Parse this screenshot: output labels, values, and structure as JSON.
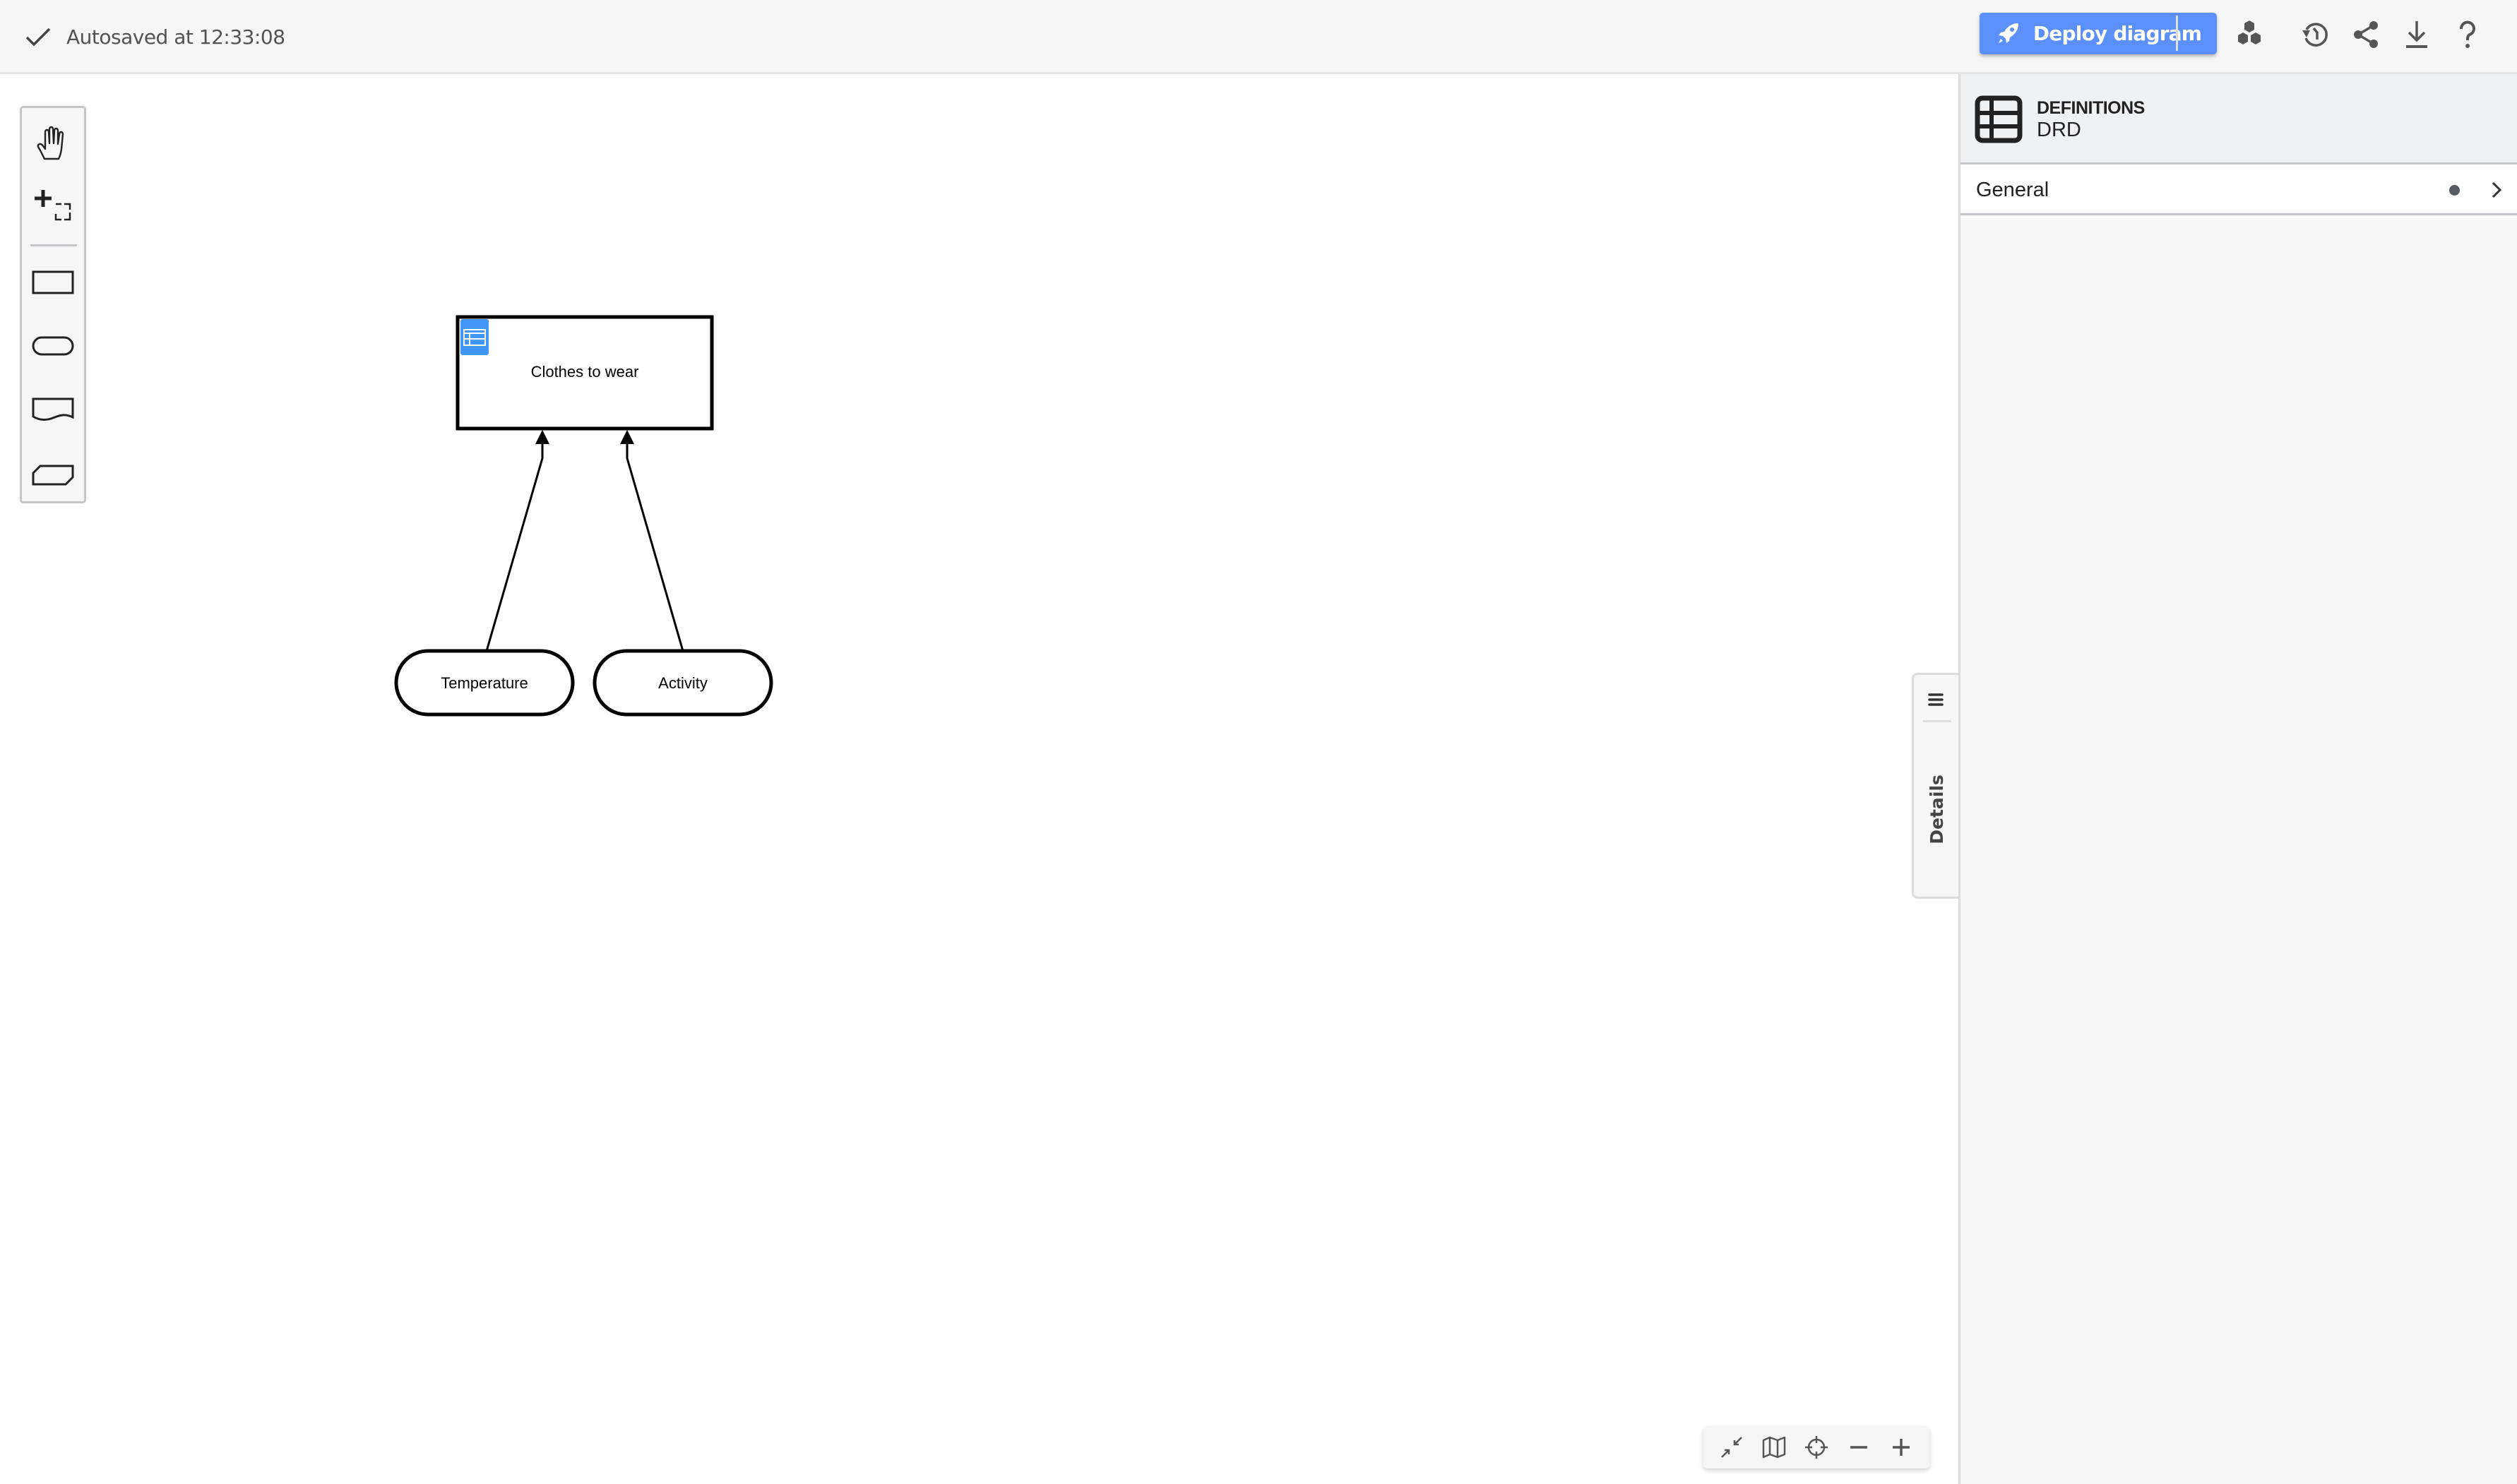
{
  "topbar": {
    "autosave_text": "Autosaved at 12:33:08",
    "deploy_label": "Deploy diagram",
    "icons": [
      "deploy-rocket-icon",
      "cluster-hexagons-icon",
      "history-icon",
      "share-icon",
      "download-icon",
      "help-icon"
    ]
  },
  "palette": {
    "tools": [
      "hand-tool",
      "lasso-tool"
    ],
    "shapes": [
      "decision",
      "input-data",
      "knowledge-source",
      "business-knowledge-model"
    ]
  },
  "diagram": {
    "decision": {
      "label": "Clothes to wear",
      "badge": "decision-table-icon"
    },
    "inputs": [
      {
        "label": "Temperature"
      },
      {
        "label": "Activity"
      }
    ],
    "connections": [
      {
        "from": "Temperature",
        "to": "Clothes to wear",
        "type": "information-requirement"
      },
      {
        "from": "Activity",
        "to": "Clothes to wear",
        "type": "information-requirement"
      }
    ]
  },
  "colors": {
    "accent": "#5b8ff9",
    "decision_badge": "#4196f7",
    "topbar_bg": "#f6f6f6",
    "panel_bg": "#f8f8f8"
  },
  "details_tab": {
    "label": "Details"
  },
  "panel": {
    "kind": "DEFINITIONS",
    "name": "DRD",
    "groups": [
      {
        "label": "General",
        "has_changes": true
      }
    ]
  },
  "zoom_controls": [
    "collapse-icon",
    "minimap-icon",
    "reset-view-icon",
    "zoom-out-icon",
    "zoom-in-icon"
  ]
}
